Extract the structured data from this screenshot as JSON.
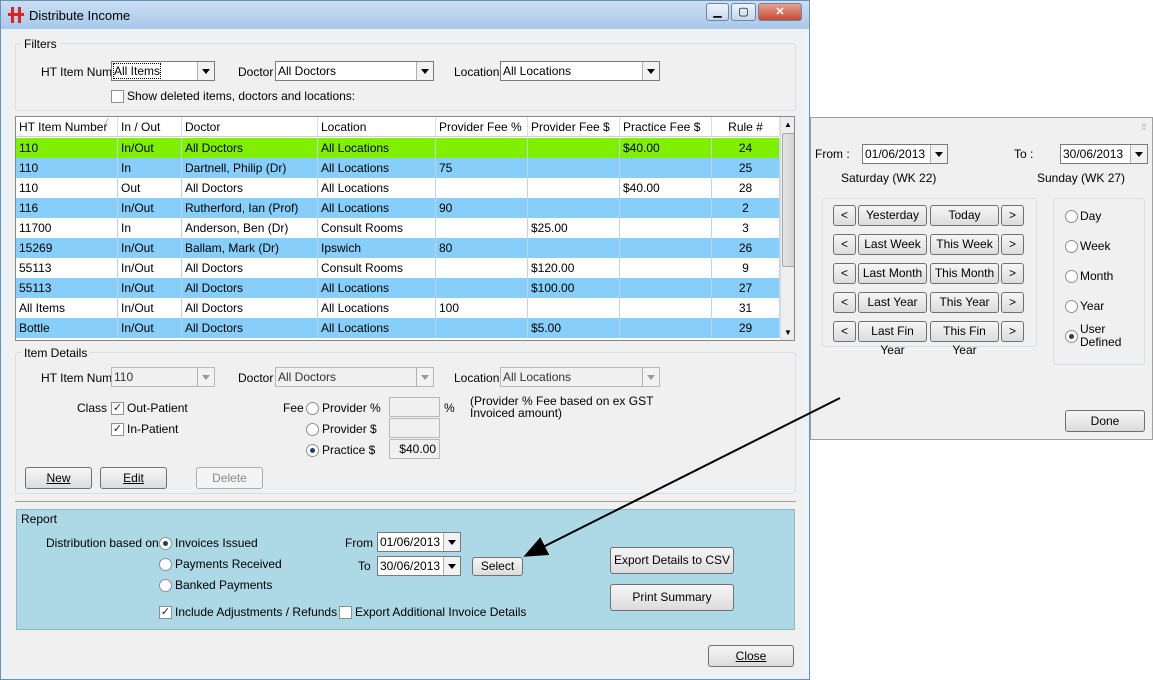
{
  "window": {
    "title": "Distribute Income",
    "close_label": "Close"
  },
  "filters": {
    "group_label": "Filters",
    "ht_item_label": "HT Item Num",
    "ht_item_value": "All Items",
    "doctor_label": "Doctor",
    "doctor_value": "All Doctors",
    "location_label": "Location",
    "location_value": "All Locations",
    "show_deleted_label": "Show deleted items, doctors and locations:",
    "show_deleted_checked": false
  },
  "table": {
    "columns": [
      "HT Item Number",
      "In / Out",
      "Doctor",
      "Location",
      "Provider Fee %",
      "Provider Fee $",
      "Practice Fee $",
      "Rule #"
    ],
    "rows": [
      {
        "item": "110",
        "inout": "In/Out",
        "doctor": "All Doctors",
        "location": "All Locations",
        "pfp": "",
        "pfd": "",
        "prf": "$40.00",
        "rule": "24",
        "style": "selected"
      },
      {
        "item": "110",
        "inout": "In",
        "doctor": "Dartnell, Philip (Dr)",
        "location": "All Locations",
        "pfp": "75",
        "pfd": "",
        "prf": "",
        "rule": "25",
        "style": "blue"
      },
      {
        "item": "110",
        "inout": "Out",
        "doctor": "All Doctors",
        "location": "All Locations",
        "pfp": "",
        "pfd": "",
        "prf": "$40.00",
        "rule": "28",
        "style": "white"
      },
      {
        "item": "116",
        "inout": "In/Out",
        "doctor": "Rutherford, Ian (Prof)",
        "location": "All Locations",
        "pfp": "90",
        "pfd": "",
        "prf": "",
        "rule": "2",
        "style": "blue"
      },
      {
        "item": "11700",
        "inout": "In",
        "doctor": "Anderson, Ben (Dr)",
        "location": "Consult Rooms",
        "pfp": "",
        "pfd": "$25.00",
        "prf": "",
        "rule": "3",
        "style": "white"
      },
      {
        "item": "15269",
        "inout": "In/Out",
        "doctor": "Ballam, Mark (Dr)",
        "location": "Ipswich",
        "pfp": "80",
        "pfd": "",
        "prf": "",
        "rule": "26",
        "style": "blue"
      },
      {
        "item": "55113",
        "inout": "In/Out",
        "doctor": "All Doctors",
        "location": "Consult Rooms",
        "pfp": "",
        "pfd": "$120.00",
        "prf": "",
        "rule": "9",
        "style": "white"
      },
      {
        "item": "55113",
        "inout": "In/Out",
        "doctor": "All Doctors",
        "location": "All Locations",
        "pfp": "",
        "pfd": "$100.00",
        "prf": "",
        "rule": "27",
        "style": "blue"
      },
      {
        "item": "All Items",
        "inout": "In/Out",
        "doctor": "All Doctors",
        "location": "All Locations",
        "pfp": "100",
        "pfd": "",
        "prf": "",
        "rule": "31",
        "style": "white"
      },
      {
        "item": "Bottle",
        "inout": "In/Out",
        "doctor": "All Doctors",
        "location": "All Locations",
        "pfp": "",
        "pfd": "$5.00",
        "prf": "",
        "rule": "29",
        "style": "blue"
      }
    ]
  },
  "item_details": {
    "group_label": "Item Details",
    "ht_item_label": "HT Item Num",
    "ht_item_value": "110",
    "doctor_label": "Doctor",
    "doctor_value": "All Doctors",
    "location_label": "Location",
    "location_value": "All Locations",
    "class_label": "Class",
    "out_patient_label": "Out-Patient",
    "in_patient_label": "In-Patient",
    "fee_label": "Fee",
    "provider_pct_label": "Provider %",
    "provider_dollar_label": "Provider $",
    "practice_dollar_label": "Practice $",
    "percent_sign": "%",
    "practice_value": "$40.00",
    "note": "(Provider % Fee based on ex GST Invoiced amount)",
    "new_label": "New",
    "edit_label": "Edit",
    "delete_label": "Delete"
  },
  "report": {
    "group_label": "Report",
    "distribution_label": "Distribution based on:",
    "opt_invoices": "Invoices Issued",
    "opt_payments": "Payments Received",
    "opt_banked": "Banked Payments",
    "from_label": "From",
    "from_value": "01/06/2013",
    "to_label": "To",
    "to_value": "30/06/2013",
    "select_label": "Select",
    "include_adj_label": "Include Adjustments / Refunds",
    "export_additional_label": "Export Additional Invoice Details",
    "export_csv_label": "Export Details to CSV",
    "print_summary_label": "Print Summary"
  },
  "date_popup": {
    "from_label": "From :",
    "from_value": "01/06/2013",
    "from_day": "Saturday (WK 22)",
    "to_label": "To :",
    "to_value": "30/06/2013",
    "to_day": "Sunday (WK 27)",
    "prev_glyph": "<",
    "next_glyph": ">",
    "periods": [
      [
        "Yesterday",
        "Today"
      ],
      [
        "Last Week",
        "This Week"
      ],
      [
        "Last Month",
        "This Month"
      ],
      [
        "Last Year",
        "This Year"
      ],
      [
        "Last Fin Year",
        "This Fin Year"
      ]
    ],
    "radios": [
      "Day",
      "Week",
      "Month",
      "Year",
      "User Defined"
    ],
    "selected_radio": "User Defined",
    "done_label": "Done"
  },
  "colors": {
    "selected_row": "#80f000",
    "alt_row": "#87cefa",
    "report_bg": "#add8e6"
  }
}
